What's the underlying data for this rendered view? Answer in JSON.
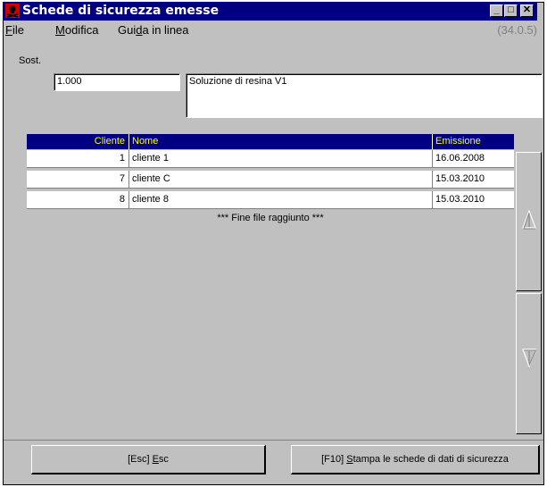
{
  "window": {
    "title": "Schede di sicurezza emesse",
    "version": "(34.0.5)"
  },
  "menu": {
    "file": {
      "first": "F",
      "rest": "ile"
    },
    "modifica": {
      "first": "M",
      "rest": "odifica"
    },
    "guida": {
      "before": "Gui",
      "ul": "d",
      "after": "a in linea"
    }
  },
  "form": {
    "sost_label": "Sost.",
    "sost_value": "1.000",
    "description": "Soluzione di resina V1"
  },
  "table": {
    "headers": {
      "cliente": "Cliente",
      "nome": "Nome",
      "emissione": "Emissione"
    },
    "rows": [
      {
        "cliente": "1",
        "nome": "cliente 1",
        "emissione": "16.06.2008"
      },
      {
        "cliente": "7",
        "nome": "cliente C",
        "emissione": "15.03.2010"
      },
      {
        "cliente": "8",
        "nome": "cliente 8",
        "emissione": "15.03.2010"
      }
    ],
    "eof_message": "*** Fine file raggiunto ***"
  },
  "buttons": {
    "esc": {
      "prefix": "[Esc] ",
      "ul": "E",
      "rest": "sc"
    },
    "print": {
      "prefix": "[F10] ",
      "ul": "S",
      "rest": "tampa le schede di dati di sicurezza"
    }
  },
  "colors": {
    "titlebar": "#000080",
    "header_text": "#ffff00",
    "face": "#c0c0c0"
  },
  "icons": [
    "app-icon",
    "minimize-icon",
    "maximize-icon",
    "close-icon",
    "scroll-up-icon",
    "scroll-down-icon"
  ]
}
